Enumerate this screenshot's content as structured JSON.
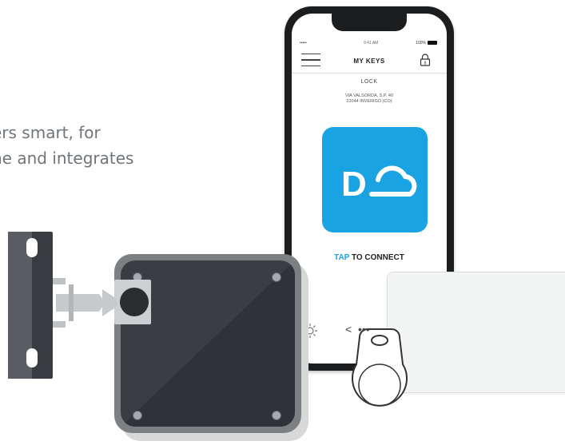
{
  "hero": {
    "line1": "ers smart, for",
    "line2": "ne and integrates"
  },
  "status_bar": {
    "signal": "•••••",
    "time": "9:41 AM",
    "battery": "100%"
  },
  "app": {
    "title": "MY KEYS",
    "lock_name": "LOCK",
    "address_line1": "VIA VALSORDA, S.P. 40",
    "address_line2": "22044 INVERIGO (CO)",
    "connect_tap": "TAP",
    "connect_rest": " TO CONNECT",
    "logo_letter": "D"
  },
  "pager": {
    "prev": "<",
    "dots": "•••"
  },
  "colors": {
    "brand_blue": "#1aa3e3",
    "lock_dark": "#3a3e44",
    "text_gray": "#6f7479"
  },
  "icons": {
    "menu": "hamburger-menu-icon",
    "lock": "padlock-icon",
    "settings": "gear-icon",
    "cloud": "cloud-logo-icon"
  }
}
